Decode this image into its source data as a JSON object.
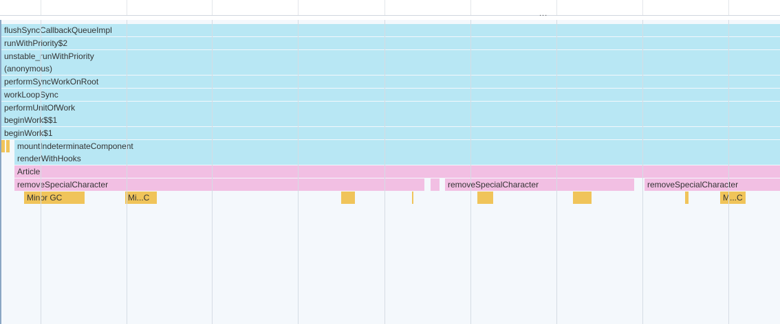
{
  "ruler": {
    "overflow_indicator": "..."
  },
  "colors": {
    "script_frame": "#b8e7f4",
    "component_frame": "#f2bfe3",
    "gc_frame": "#f0c45a",
    "background": "#f4f8fc"
  },
  "frames": {
    "flush_sync": "flushSyncCallbackQueueImpl",
    "run_with_priority_2": "runWithPriority$2",
    "unstable_run_with_priority": "unstable_runWithPriority",
    "anonymous": "(anonymous)",
    "perform_sync_work": "performSyncWorkOnRoot",
    "work_loop_sync": "workLoopSync",
    "perform_unit_of_work": "performUnitOfWork",
    "begin_work_1": "beginWork$$1",
    "begin_work_2": "beginWork$1",
    "mount_indeterminate": "mountIndeterminateComponent",
    "render_with_hooks": "renderWithHooks",
    "article": "Article",
    "remove_special_1": "removeSpecialCharacter",
    "remove_special_2": "removeSpecialCharacter",
    "remove_special_3": "removeSpecialCharacter",
    "minor_gc_1": "Minor GC",
    "minor_gc_2": "Mi...C",
    "minor_gc_8": "M...C"
  }
}
